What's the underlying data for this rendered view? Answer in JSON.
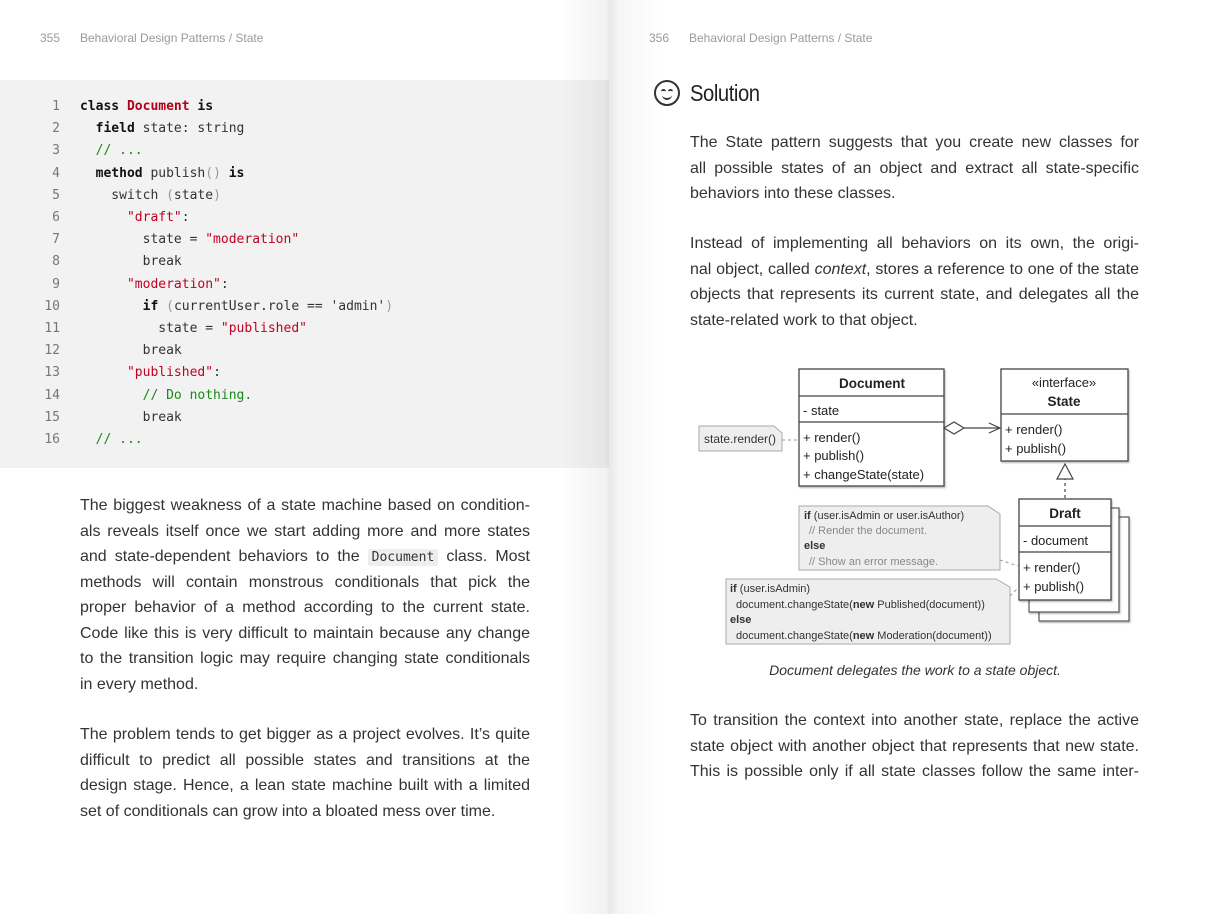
{
  "left_page": {
    "page_number": "355",
    "running_title": "Behavioral Design Patterns / State",
    "code": [
      {
        "n": "1",
        "parts": [
          {
            "t": "class ",
            "c": "kw"
          },
          {
            "t": "Document",
            "c": "cls"
          },
          {
            "t": " is",
            "c": "kw"
          }
        ]
      },
      {
        "n": "2",
        "parts": [
          {
            "t": "  field",
            "c": "kw"
          },
          {
            "t": " state: string",
            "c": ""
          }
        ]
      },
      {
        "n": "3",
        "parts": [
          {
            "t": "  // ...",
            "c": "cmt"
          }
        ]
      },
      {
        "n": "4",
        "parts": [
          {
            "t": "  method",
            "c": "kw"
          },
          {
            "t": " publish",
            "c": ""
          },
          {
            "t": "()",
            "c": "pn"
          },
          {
            "t": " is",
            "c": "kw"
          }
        ]
      },
      {
        "n": "5",
        "parts": [
          {
            "t": "    switch ",
            "c": ""
          },
          {
            "t": "(",
            "c": "pn"
          },
          {
            "t": "state",
            "c": ""
          },
          {
            "t": ")",
            "c": "pn"
          }
        ]
      },
      {
        "n": "6",
        "parts": [
          {
            "t": "      ",
            "c": ""
          },
          {
            "t": "\"draft\"",
            "c": "str"
          },
          {
            "t": ":",
            "c": ""
          }
        ]
      },
      {
        "n": "7",
        "parts": [
          {
            "t": "        state = ",
            "c": ""
          },
          {
            "t": "\"moderation\"",
            "c": "str"
          }
        ]
      },
      {
        "n": "8",
        "parts": [
          {
            "t": "        break",
            "c": ""
          }
        ]
      },
      {
        "n": "9",
        "parts": [
          {
            "t": "      ",
            "c": ""
          },
          {
            "t": "\"moderation\"",
            "c": "str"
          },
          {
            "t": ":",
            "c": ""
          }
        ]
      },
      {
        "n": "10",
        "parts": [
          {
            "t": "        if",
            "c": "kw"
          },
          {
            "t": " (",
            "c": "pn"
          },
          {
            "t": "currentUser.role == 'admin'",
            "c": ""
          },
          {
            "t": ")",
            "c": "pn"
          }
        ]
      },
      {
        "n": "11",
        "parts": [
          {
            "t": "          state = ",
            "c": ""
          },
          {
            "t": "\"published\"",
            "c": "str"
          }
        ]
      },
      {
        "n": "12",
        "parts": [
          {
            "t": "        break",
            "c": ""
          }
        ]
      },
      {
        "n": "13",
        "parts": [
          {
            "t": "      ",
            "c": ""
          },
          {
            "t": "\"published\"",
            "c": "str"
          },
          {
            "t": ":",
            "c": ""
          }
        ]
      },
      {
        "n": "14",
        "parts": [
          {
            "t": "        // Do nothing.",
            "c": "cmt"
          }
        ]
      },
      {
        "n": "15",
        "parts": [
          {
            "t": "        break",
            "c": ""
          }
        ]
      },
      {
        "n": "16",
        "parts": [
          {
            "t": "  // ...",
            "c": "cmt"
          }
        ]
      }
    ],
    "para1": [
      "The biggest weakness of a state machine based on condition-",
      "als reveals itself once we start adding more and more states",
      "and state-dependent behaviors to the ",
      "methods will contain monstrous conditionals that pick the",
      "proper behavior of a method according to the current state.",
      "Code like this is very difficult to maintain because any change",
      "to the transition logic may require changing state conditionals",
      "in every method."
    ],
    "para1_inline_code": "Document",
    "para1_after_code": " class. Most",
    "para2": [
      "The problem tends to get bigger as a project evolves. It’s quite",
      "difficult to predict all possible states and transitions at the",
      "design stage. Hence, a lean state machine built with a limited",
      "set of conditionals can grow into a bloated mess over time."
    ]
  },
  "right_page": {
    "page_number": "356",
    "running_title": "Behavioral Design Patterns / State",
    "section_title": "Solution",
    "para1": [
      "The State pattern suggests that you create new classes for",
      "all possible states of an object and extract all state-specific",
      "behaviors into these classes."
    ],
    "para2_lines": [
      "Instead of implementing all behaviors on its own, the origi-",
      "objects that represents its current state, and delegates all the",
      "state-related work to that object."
    ],
    "para2_line2_pre": "nal object, called ",
    "para2_line2_em": "context",
    "para2_line2_post": ", stores a reference to one of the state",
    "diagram": {
      "document_class": "Document",
      "document_field": "- state",
      "document_methods": [
        "+ render()",
        "+ publish()",
        "+ changeState(state)"
      ],
      "state_stereotype": "«interface»",
      "state_class": "State",
      "state_methods": [
        "+ render()",
        "+ publish()"
      ],
      "draft_class": "Draft",
      "draft_field": "- document",
      "draft_methods": [
        "+ render()",
        "+ publish()"
      ],
      "note_render": "state.render()",
      "note_draft_render": [
        "if (user.isAdmin or user.isAuthor)",
        "  // Render the document.",
        "else",
        "  // Show an error message."
      ],
      "note_draft_publish": [
        "if (user.isAdmin)",
        "  document.changeState(new Published(document))",
        "else",
        "  document.changeState(new Moderation(document))"
      ]
    },
    "caption": "Document delegates the work to a state object.",
    "para3": [
      "To transition the context into another state, replace the active",
      "state object with another object that represents that new state.",
      "This is possible only if all state classes follow the same inter-"
    ]
  }
}
